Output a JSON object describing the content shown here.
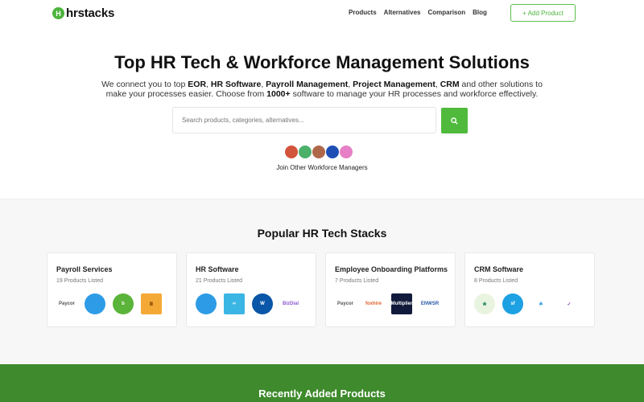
{
  "header": {
    "brand": "hrstacks",
    "brand_mark": "H",
    "nav": [
      "Products",
      "Alternatives",
      "Comparison",
      "Blog"
    ],
    "add_product": "+ Add Product"
  },
  "hero": {
    "title": "Top HR Tech & Workforce Management Solutions",
    "sub": [
      "We connect you to top ",
      "EOR",
      ", ",
      "HR Software",
      ", ",
      "Payroll Management",
      ", ",
      "Project Management",
      ", ",
      "CRM",
      " and other solutions to make your processes easier. Choose from ",
      "1000+",
      " software to manage your HR processes and workforce effectively."
    ],
    "search_placeholder": "Search products, categories, alternatives...",
    "join": "Join Other Workforce Managers",
    "avatar_colors": [
      "#d2543a",
      "#4caf6a",
      "#b0684a",
      "#1f4fb5",
      "#e67fc6"
    ]
  },
  "popular": {
    "title": "Popular HR Tech Stacks",
    "cards": [
      {
        "title": "Payroll Services",
        "count": "19 Products Listed",
        "logos": [
          {
            "name": "Paycor",
            "bg": "#fff",
            "fg": "#555",
            "sq": true
          },
          {
            "name": "",
            "bg": "#2d9be6",
            "fg": "#fff"
          },
          {
            "name": "b",
            "bg": "#5ab43a",
            "fg": "#fff"
          },
          {
            "name": "Ⅲ",
            "bg": "#f4a936",
            "fg": "#7a3b00",
            "sq": true
          }
        ]
      },
      {
        "title": "HR Software",
        "count": "21 Products Listed",
        "logos": [
          {
            "name": "",
            "bg": "#2d9be6",
            "fg": "#fff"
          },
          {
            "name": "∞",
            "bg": "#3bb5e3",
            "fg": "#fff",
            "sq": true
          },
          {
            "name": "W",
            "bg": "#0a56a8",
            "fg": "#fff"
          },
          {
            "name": "BizDial",
            "bg": "#fff",
            "fg": "#8a5ad0",
            "sq": true
          }
        ]
      },
      {
        "title": "Employee Onboarding Platforms",
        "count": "7 Products Listed",
        "logos": [
          {
            "name": "Paycor",
            "bg": "#fff",
            "fg": "#555",
            "sq": true
          },
          {
            "name": "foxhire",
            "bg": "#fff",
            "fg": "#e0602a",
            "sq": true
          },
          {
            "name": "Multiplier",
            "bg": "#111a3a",
            "fg": "#fff",
            "sq": true
          },
          {
            "name": "ENWSR",
            "bg": "#fff",
            "fg": "#2a5aa8",
            "sq": true
          }
        ]
      },
      {
        "title": "CRM Software",
        "count": "8 Products Listed",
        "logos": [
          {
            "name": "❀",
            "bg": "#e9f4e0",
            "fg": "#2a8a6a"
          },
          {
            "name": "sf",
            "bg": "#1da1e2",
            "fg": "#fff"
          },
          {
            "name": "☘",
            "bg": "#fff",
            "fg": "#3aa0e0"
          },
          {
            "name": "✓",
            "bg": "#fff",
            "fg": "#7a3aa0"
          }
        ]
      }
    ]
  },
  "recent": {
    "title": "Recently Added Products"
  }
}
